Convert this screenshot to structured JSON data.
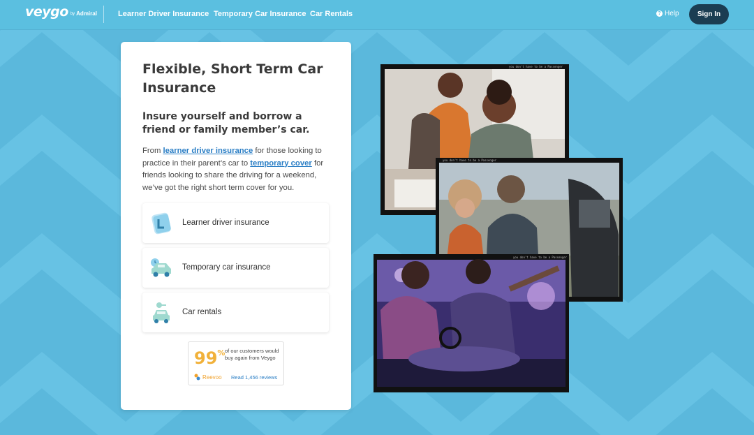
{
  "nav": {
    "logo": {
      "word": "veygo",
      "by": "by",
      "sub": "Admiral"
    },
    "links": [
      "Learner Driver Insurance",
      "Temporary Car Insurance",
      "Car Rentals"
    ],
    "help_label": "Help",
    "help_icon": "question-icon",
    "signin_label": "Sign In"
  },
  "hero": {
    "title": "Flexible, Short Term Car Insurance",
    "subtitle": "Insure yourself and borrow a friend or family member’s car.",
    "para_1": "From ",
    "link_1": "learner driver insurance",
    "para_2": " for those looking to practice in their parent’s car to ",
    "link_2": "temporary cover",
    "para_3": " for friends looking to share the driving for a weekend, we’ve got the right short term cover for you."
  },
  "options": [
    {
      "label": "Learner driver insurance",
      "icon": "l-plate-icon"
    },
    {
      "label": "Temporary car insurance",
      "icon": "car-clock-icon"
    },
    {
      "label": "Car rentals",
      "icon": "car-key-icon"
    }
  ],
  "reevoo": {
    "percent": "99",
    "percent_symbol": "%",
    "text": "of our customers would buy again from Veygo",
    "brand": "Reevoo",
    "reviews_link": "Read 1,456 reviews"
  },
  "photos": {
    "film_caption": "you don't have to be a Passenger"
  },
  "colors": {
    "background": "#5bb8dc",
    "nav_button": "#1b3d52",
    "link": "#2a7ec5",
    "rating": "#f1b13a"
  }
}
